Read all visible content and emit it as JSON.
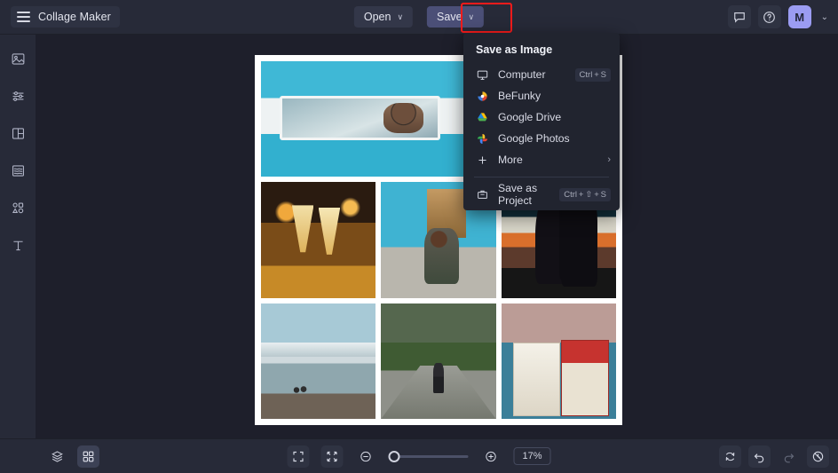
{
  "app": {
    "title": "Collage Maker",
    "menu_icon": "hamburger-icon"
  },
  "header": {
    "open_label": "Open",
    "save_label": "Save",
    "chevron": "∨",
    "feedback_icon": "feedback-icon",
    "help_icon": "help-circle-icon",
    "avatar_initial": "M",
    "account_caret": "⌄",
    "save_highlight_color": "#f51b1b"
  },
  "sidebar": {
    "items": [
      {
        "name": "image-manager",
        "icon": "image-icon"
      },
      {
        "name": "edit-adjust",
        "icon": "sliders-icon"
      },
      {
        "name": "layouts",
        "icon": "layout-icon"
      },
      {
        "name": "backgrounds",
        "icon": "background-icon"
      },
      {
        "name": "graphics",
        "icon": "graphics-icon"
      },
      {
        "name": "text",
        "icon": "text-icon"
      }
    ]
  },
  "save_menu": {
    "title": "Save as Image",
    "items": [
      {
        "label": "Computer",
        "icon": "computer-icon",
        "shortcut": "Ctrl + S"
      },
      {
        "label": "BeFunky",
        "icon": "befunky-icon",
        "shortcut": ""
      },
      {
        "label": "Google Drive",
        "icon": "google-drive-icon",
        "shortcut": ""
      },
      {
        "label": "Google Photos",
        "icon": "google-photos-icon",
        "shortcut": ""
      },
      {
        "label": "More",
        "icon": "plus-icon",
        "shortcut": "",
        "arrow": "›"
      }
    ],
    "project_item": {
      "label": "Save as Project",
      "icon": "save-project-icon",
      "shortcut": "Ctrl + ⇧ + S"
    }
  },
  "canvas": {
    "cells": [
      {
        "name": "photo-van-thumbs-up",
        "art": "p-van",
        "span": 2
      },
      {
        "name": "photo-cliff-road",
        "art": "p-cliff",
        "span": 1
      },
      {
        "name": "photo-champagne-toast",
        "art": "p-glasses",
        "span": 1
      },
      {
        "name": "photo-couple-van",
        "art": "p-couplevan",
        "span": 1
      },
      {
        "name": "photo-sunset-silhouette",
        "art": "p-sunset",
        "span": 1
      },
      {
        "name": "photo-lake-mountains",
        "art": "p-lake",
        "span": 1
      },
      {
        "name": "photo-tropical-road",
        "art": "p-road",
        "span": 1
      },
      {
        "name": "photo-travel-book",
        "art": "p-book",
        "span": 1
      }
    ]
  },
  "bottom_bar": {
    "layers_icon": "layers-icon",
    "grid_icon": "grid-icon",
    "fit_screen_icon": "fit-screen-icon",
    "fit_content_icon": "fit-content-icon",
    "zoom_out_icon": "zoom-out-icon",
    "zoom_in_icon": "zoom-in-icon",
    "zoom_level": "17%",
    "zoom_slider_percent": 4,
    "reset_icon": "reset-icon",
    "undo_icon": "undo-icon",
    "redo_icon": "redo-icon",
    "history_icon": "history-icon"
  }
}
